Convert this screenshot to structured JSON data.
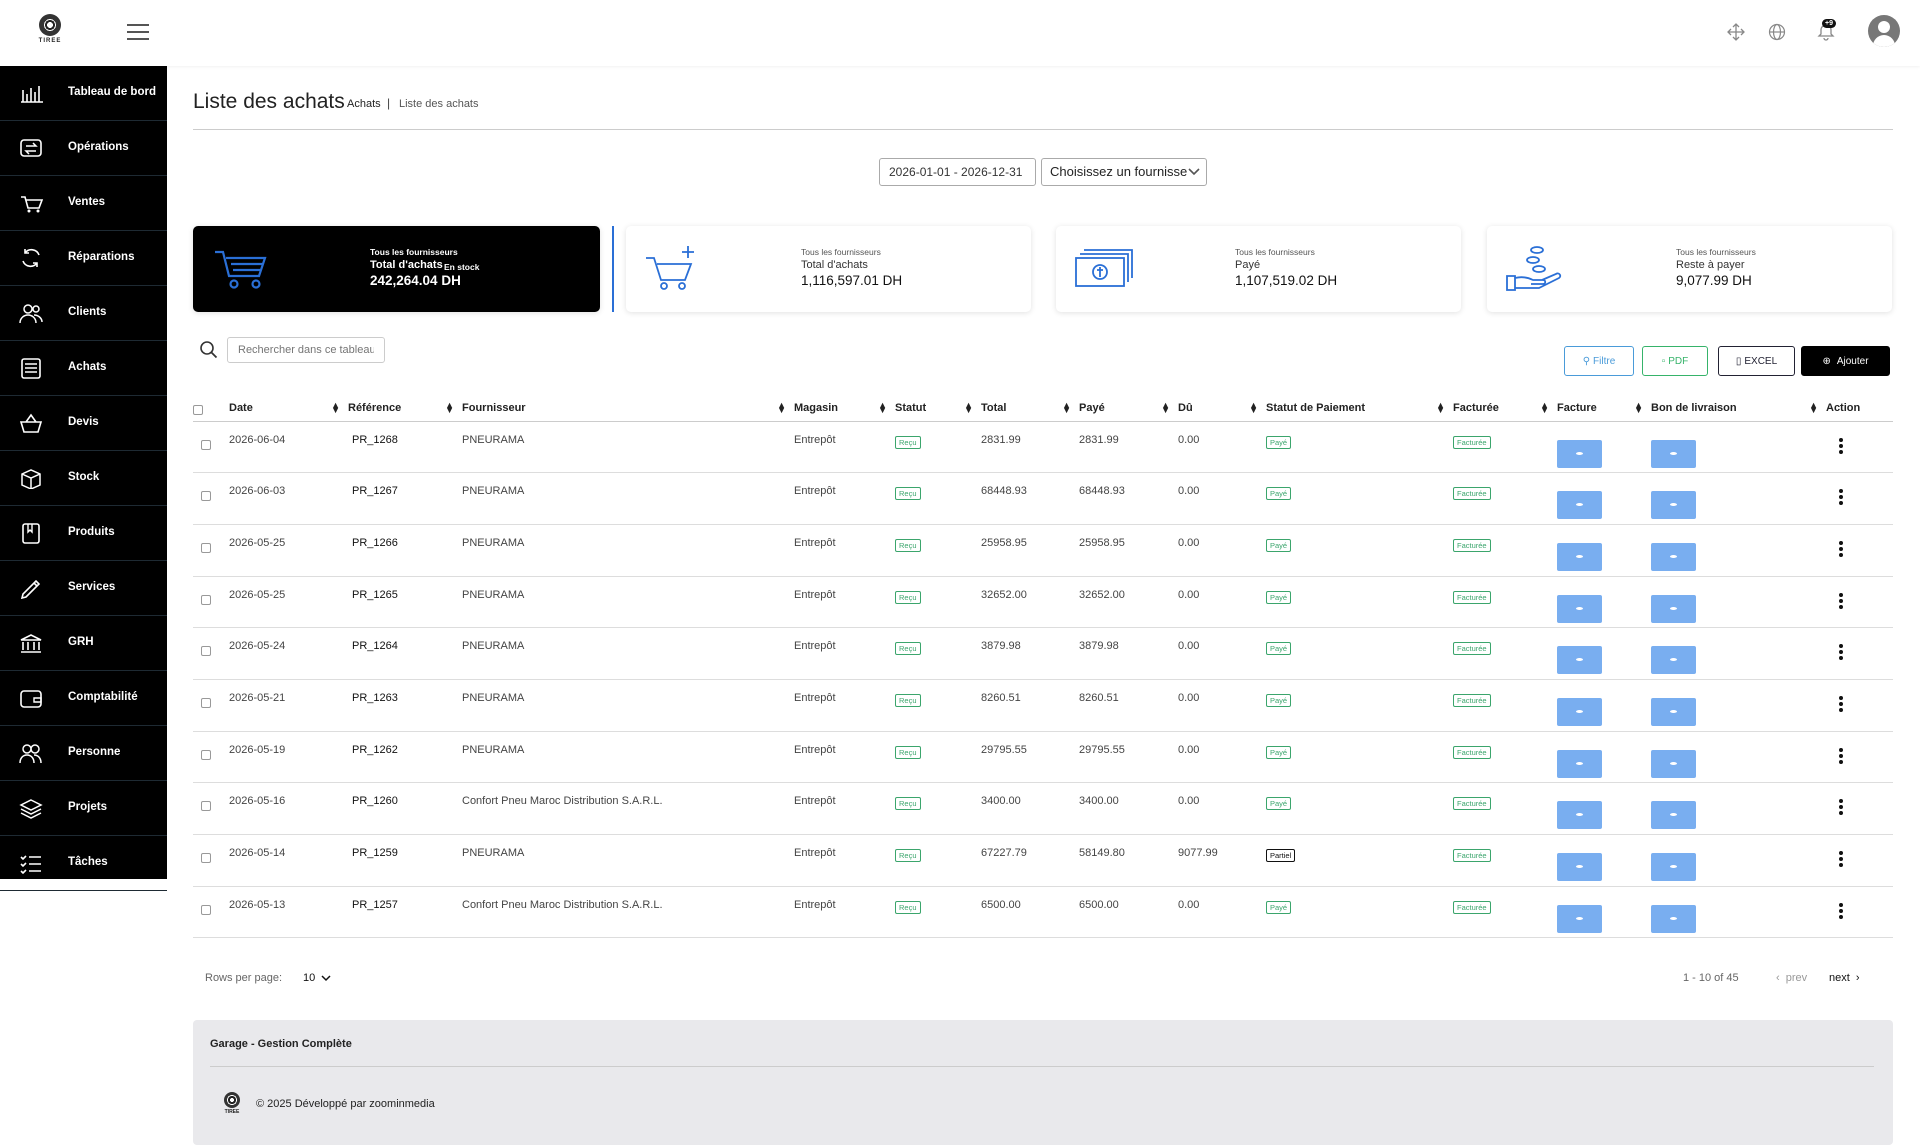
{
  "brand": {
    "logo_text": "TIREE"
  },
  "topbar": {
    "notif_count": "+9"
  },
  "sidebar": {
    "items": [
      {
        "label": "Tableau de bord",
        "icon": "chart-bar-icon"
      },
      {
        "label": "Opérations",
        "icon": "transfer-icon"
      },
      {
        "label": "Ventes",
        "icon": "cart-icon"
      },
      {
        "label": "Réparations",
        "icon": "refresh-icon"
      },
      {
        "label": "Clients",
        "icon": "users-icon"
      },
      {
        "label": "Achats",
        "icon": "receipt-icon"
      },
      {
        "label": "Devis",
        "icon": "basket-icon"
      },
      {
        "label": "Stock",
        "icon": "box-icon"
      },
      {
        "label": "Produits",
        "icon": "book-icon"
      },
      {
        "label": "Services",
        "icon": "pen-icon"
      },
      {
        "label": "GRH",
        "icon": "bank-icon"
      },
      {
        "label": "Comptabilité",
        "icon": "wallet-icon"
      },
      {
        "label": "Personne",
        "icon": "people-icon"
      },
      {
        "label": "Projets",
        "icon": "layers-icon"
      },
      {
        "label": "Tâches",
        "icon": "tasks-icon"
      }
    ]
  },
  "page": {
    "title": "Liste des achats",
    "crumb_parent": "Achats",
    "crumb_sep": "|",
    "crumb_current": "Liste des achats"
  },
  "filters": {
    "date_range": "2026-01-01 - 2026-12-31",
    "supplier_select": "Choisissez un fournisseur"
  },
  "cards": [
    {
      "small": "Tous les fournisseurs",
      "label": "Total d'achats",
      "tag": "En stock",
      "value": "242,264.04 DH"
    },
    {
      "small": "Tous les fournisseurs",
      "label": "Total d'achats",
      "value": "1,116,597.01 DH"
    },
    {
      "small": "Tous les fournisseurs",
      "label": "Payé",
      "value": "1,107,519.02 DH"
    },
    {
      "small": "Tous les fournisseurs",
      "label": "Reste à payer",
      "value": "9,077.99 DH"
    }
  ],
  "search": {
    "placeholder": "Rechercher dans ce tableau"
  },
  "buttons": {
    "filtre": "Filtre",
    "pdf": "PDF",
    "excel": "EXCEL",
    "add": "Ajouter"
  },
  "table": {
    "headers": [
      "Date",
      "Référence",
      "Fournisseur",
      "Magasin",
      "Statut",
      "Total",
      "Payé",
      "Dû",
      "Statut de Paiement",
      "Facturée",
      "Facture",
      "Bon de livraison",
      "Action"
    ],
    "rows": [
      {
        "date": "2026-06-04",
        "ref": "PR_1268",
        "supplier": "PNEURAMA",
        "store": "Entrepôt",
        "status": "Reçu",
        "total": "2831.99",
        "paid": "2831.99",
        "due": "0.00",
        "pay_status": "Payé",
        "invoiced": "Facturée"
      },
      {
        "date": "2026-06-03",
        "ref": "PR_1267",
        "supplier": "PNEURAMA",
        "store": "Entrepôt",
        "status": "Reçu",
        "total": "68448.93",
        "paid": "68448.93",
        "due": "0.00",
        "pay_status": "Payé",
        "invoiced": "Facturée"
      },
      {
        "date": "2026-05-25",
        "ref": "PR_1266",
        "supplier": "PNEURAMA",
        "store": "Entrepôt",
        "status": "Reçu",
        "total": "25958.95",
        "paid": "25958.95",
        "due": "0.00",
        "pay_status": "Payé",
        "invoiced": "Facturée"
      },
      {
        "date": "2026-05-25",
        "ref": "PR_1265",
        "supplier": "PNEURAMA",
        "store": "Entrepôt",
        "status": "Reçu",
        "total": "32652.00",
        "paid": "32652.00",
        "due": "0.00",
        "pay_status": "Payé",
        "invoiced": "Facturée"
      },
      {
        "date": "2026-05-24",
        "ref": "PR_1264",
        "supplier": "PNEURAMA",
        "store": "Entrepôt",
        "status": "Reçu",
        "total": "3879.98",
        "paid": "3879.98",
        "due": "0.00",
        "pay_status": "Payé",
        "invoiced": "Facturée"
      },
      {
        "date": "2026-05-21",
        "ref": "PR_1263",
        "supplier": "PNEURAMA",
        "store": "Entrepôt",
        "status": "Reçu",
        "total": "8260.51",
        "paid": "8260.51",
        "due": "0.00",
        "pay_status": "Payé",
        "invoiced": "Facturée"
      },
      {
        "date": "2026-05-19",
        "ref": "PR_1262",
        "supplier": "PNEURAMA",
        "store": "Entrepôt",
        "status": "Reçu",
        "total": "29795.55",
        "paid": "29795.55",
        "due": "0.00",
        "pay_status": "Payé",
        "invoiced": "Facturée"
      },
      {
        "date": "2026-05-16",
        "ref": "PR_1260",
        "supplier": "Confort Pneu Maroc Distribution S.A.R.L.",
        "store": "Entrepôt",
        "status": "Reçu",
        "total": "3400.00",
        "paid": "3400.00",
        "due": "0.00",
        "pay_status": "Payé",
        "invoiced": "Facturée"
      },
      {
        "date": "2026-05-14",
        "ref": "PR_1259",
        "supplier": "PNEURAMA",
        "store": "Entrepôt",
        "status": "Reçu",
        "total": "67227.79",
        "paid": "58149.80",
        "due": "9077.99",
        "pay_status": "Partiel",
        "invoiced": "Facturée"
      },
      {
        "date": "2026-05-13",
        "ref": "PR_1257",
        "supplier": "Confort Pneu Maroc Distribution S.A.R.L.",
        "store": "Entrepôt",
        "status": "Reçu",
        "total": "6500.00",
        "paid": "6500.00",
        "due": "0.00",
        "pay_status": "Payé",
        "invoiced": "Facturée"
      }
    ]
  },
  "pager": {
    "rows_label": "Rows per page:",
    "rows_value": "10",
    "range": "1 - 10 of 45",
    "prev": "prev",
    "next": "next"
  },
  "footer": {
    "title": "Garage - Gestion Complète",
    "copyright": "© 2025 Développé par zoominmedia"
  },
  "colors": {
    "accent_blue": "#79aef0",
    "status_green": "#3ba56c",
    "dark": "#000000"
  }
}
